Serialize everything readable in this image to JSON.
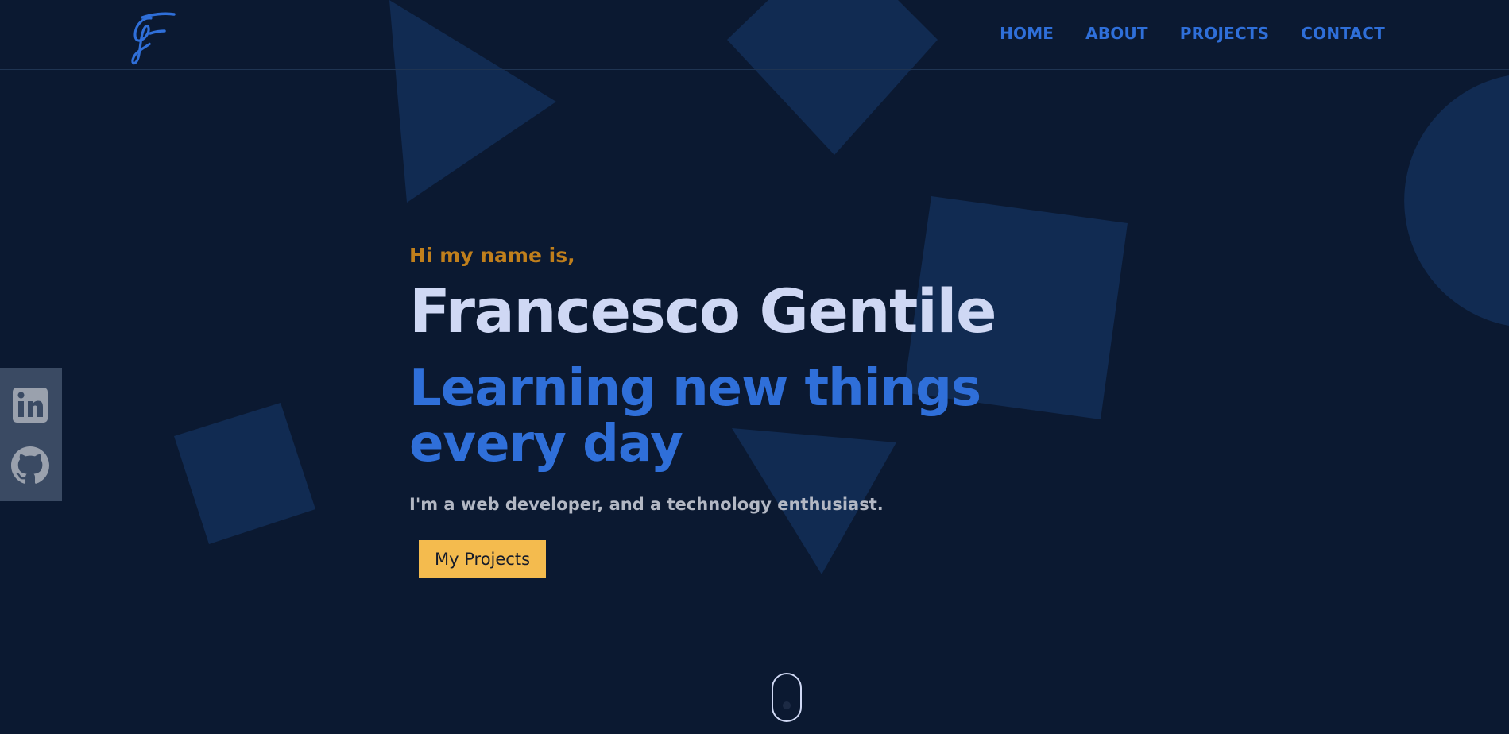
{
  "header": {
    "logo_text": "GF",
    "nav": [
      {
        "label": "HOME"
      },
      {
        "label": "ABOUT"
      },
      {
        "label": "PROJECTS"
      },
      {
        "label": "CONTACT"
      }
    ]
  },
  "social": {
    "items": [
      {
        "icon": "linkedin-icon"
      },
      {
        "icon": "github-icon"
      }
    ]
  },
  "hero": {
    "greeting": "Hi my name is,",
    "name": "Francesco Gentile",
    "tagline": "Learning new things every day",
    "description": "I'm a web developer, and a technology enthusiast.",
    "cta_label": "My Projects"
  },
  "colors": {
    "background": "#0b1931",
    "accent_blue": "#2f6fd9",
    "accent_gold": "#f4bb4e",
    "greeting_gold": "#c07f1c",
    "name_text": "#cfd8f4",
    "shape_fill": "#112b52"
  }
}
